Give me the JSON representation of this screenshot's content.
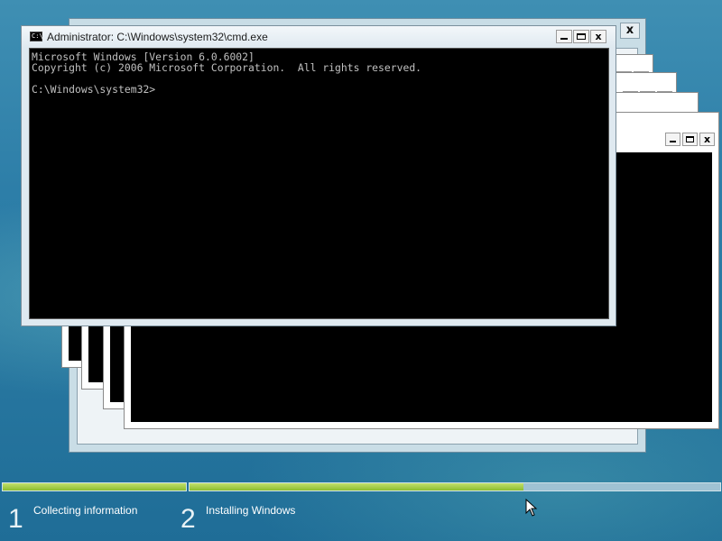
{
  "cmd": {
    "title": "Administrator: C:\\Windows\\system32\\cmd.exe",
    "console_lines": [
      "Microsoft Windows [Version 6.0.6002]",
      "Copyright (c) 2006 Microsoft Corporation.  All rights reserved.",
      "",
      "C:\\Windows\\system32>"
    ],
    "buttons": {
      "close": "x"
    }
  },
  "background_window": {
    "close": "x"
  },
  "setup_progress": {
    "step1": {
      "number": "1",
      "label": "Collecting information",
      "progress": 1.0
    },
    "step2": {
      "number": "2",
      "label": "Installing Windows",
      "progress": 0.63
    }
  },
  "colors": {
    "progress_fill": "#8cbd2f",
    "console_text": "#c0c0c0",
    "desktop": "#2d7ea8"
  }
}
